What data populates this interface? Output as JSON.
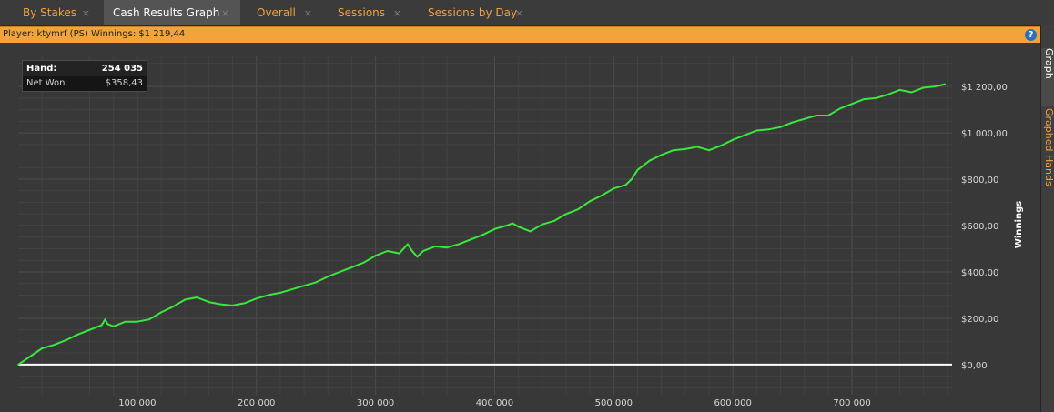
{
  "tabs": [
    {
      "label": "By Stakes",
      "active": false
    },
    {
      "label": "Cash Results Graph",
      "active": true
    },
    {
      "label": "Overall",
      "active": false
    },
    {
      "label": "Sessions",
      "active": false
    },
    {
      "label": "Sessions by Day",
      "active": false
    }
  ],
  "close_glyph": "×",
  "player_bar": {
    "text": "Player: ktymrf (PS) Winnings: $1 219,44",
    "help_glyph": "?"
  },
  "info_box": {
    "hand_label": "Hand:",
    "hand_value": "254 035",
    "netwon_label": "Net Won",
    "netwon_value": "$358,43"
  },
  "side_tabs": [
    "Graph",
    "Graphed Hands"
  ],
  "colors": {
    "accent": "#f2a33d",
    "line": "#39e83c",
    "zero_line": "#ffffff",
    "plot_bg": "#383838"
  },
  "chart_data": {
    "type": "line",
    "ylabel": "Winnings",
    "xlabel": "",
    "x_ticks": [
      "100 000",
      "200 000",
      "300 000",
      "400 000",
      "500 000",
      "600 000",
      "700 000"
    ],
    "x_tick_values": [
      100000,
      200000,
      300000,
      400000,
      500000,
      600000,
      700000
    ],
    "y_ticks": [
      "$0,00",
      "$200,00",
      "$400,00",
      "$600,00",
      "$800,00",
      "$1 000,00",
      "$1 200,00"
    ],
    "y_tick_values": [
      0,
      200,
      400,
      600,
      800,
      1000,
      1200
    ],
    "xlim": [
      0,
      784000
    ],
    "ylim": [
      -130,
      1330
    ],
    "grid": true,
    "series": [
      {
        "x": [
          0,
          10000,
          20000,
          30000,
          40000,
          50000,
          60000,
          70000,
          73000,
          75000,
          80000,
          90000,
          100000,
          110000,
          120000,
          130000,
          140000,
          150000,
          155000,
          160000,
          170000,
          180000,
          190000,
          200000,
          210000,
          220000,
          230000,
          240000,
          250000,
          260000,
          270000,
          280000,
          290000,
          300000,
          310000,
          320000,
          327000,
          330000,
          335000,
          340000,
          350000,
          360000,
          370000,
          380000,
          390000,
          400000,
          410000,
          415000,
          420000,
          430000,
          440000,
          450000,
          460000,
          470000,
          480000,
          490000,
          500000,
          510000,
          515000,
          520000,
          530000,
          540000,
          550000,
          560000,
          570000,
          580000,
          590000,
          600000,
          610000,
          620000,
          630000,
          640000,
          650000,
          660000,
          670000,
          680000,
          690000,
          700000,
          710000,
          720000,
          730000,
          740000,
          750000,
          760000,
          770000,
          778000
        ],
        "values": [
          0,
          35,
          70,
          85,
          105,
          130,
          150,
          170,
          195,
          175,
          165,
          185,
          185,
          195,
          225,
          250,
          280,
          290,
          280,
          270,
          260,
          255,
          265,
          285,
          300,
          310,
          325,
          340,
          355,
          380,
          400,
          420,
          440,
          470,
          490,
          480,
          520,
          495,
          465,
          490,
          510,
          505,
          520,
          540,
          560,
          585,
          600,
          610,
          595,
          575,
          605,
          620,
          650,
          670,
          705,
          730,
          760,
          775,
          800,
          840,
          880,
          905,
          925,
          930,
          940,
          925,
          945,
          970,
          990,
          1010,
          1015,
          1025,
          1045,
          1060,
          1075,
          1075,
          1105,
          1125,
          1145,
          1150,
          1165,
          1185,
          1175,
          1195,
          1200,
          1210
        ]
      }
    ]
  }
}
